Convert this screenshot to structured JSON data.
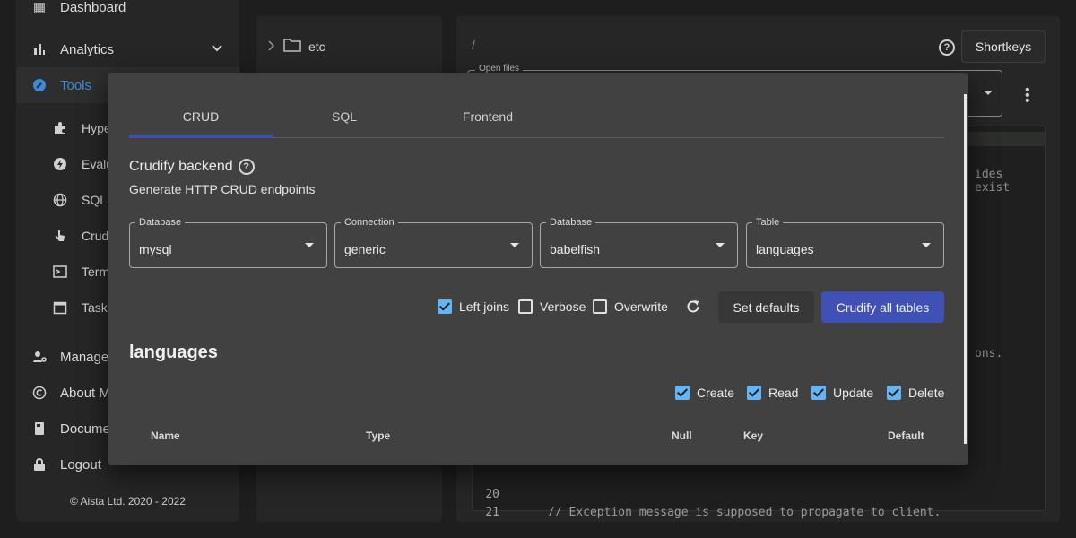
{
  "sidebar": {
    "top_partial": "Dashboard",
    "items": [
      {
        "label": "Analytics"
      },
      {
        "label": "Tools"
      }
    ],
    "sub_items": [
      {
        "label": "Hype"
      },
      {
        "label": "Evalu"
      },
      {
        "label": "SQL"
      },
      {
        "label": "Crudi"
      },
      {
        "label": "Term"
      },
      {
        "label": "Tasks"
      }
    ],
    "bottom_items": [
      {
        "label": "Manage"
      },
      {
        "label": "About M"
      },
      {
        "label": "Docume"
      },
      {
        "label": "Logout"
      }
    ],
    "copyright": "© Aista Ltd. 2020 - 2022"
  },
  "files": {
    "folder": "etc"
  },
  "editor": {
    "path": "/",
    "help": "?",
    "shortkeys_label": "Shortkeys",
    "open_files_label": "Open files",
    "code_fragment_1": "ides exist",
    "code_fragment_2": "ons.",
    "lines": [
      {
        "no": "20",
        "text": ""
      },
      {
        "no": "21",
        "text": "// Exception message is supposed to propagate to client."
      }
    ]
  },
  "modal": {
    "tabs": [
      "CRUD",
      "SQL",
      "Frontend"
    ],
    "active_tab": 0,
    "title": "Crudify backend",
    "help": "?",
    "subtitle": "Generate HTTP CRUD endpoints",
    "fields": [
      {
        "legend": "Database",
        "value": "mysql"
      },
      {
        "legend": "Connection",
        "value": "generic"
      },
      {
        "legend": "Database",
        "value": "babelfish"
      },
      {
        "legend": "Table",
        "value": "languages"
      }
    ],
    "options": [
      {
        "label": "Left joins",
        "checked": true
      },
      {
        "label": "Verbose",
        "checked": false
      },
      {
        "label": "Overwrite",
        "checked": false
      }
    ],
    "set_defaults_label": "Set defaults",
    "crudify_all_label": "Crudify all tables",
    "table_title": "languages",
    "verbs": [
      {
        "label": "Create",
        "checked": true
      },
      {
        "label": "Read",
        "checked": true
      },
      {
        "label": "Update",
        "checked": true
      },
      {
        "label": "Delete",
        "checked": true
      }
    ],
    "columns": [
      "Name",
      "Type",
      "Null",
      "Key",
      "Default"
    ]
  },
  "colors": {
    "accent": "#3f51b5",
    "checkbox": "#64b5f6",
    "active_nav": "#3d8ad8"
  }
}
